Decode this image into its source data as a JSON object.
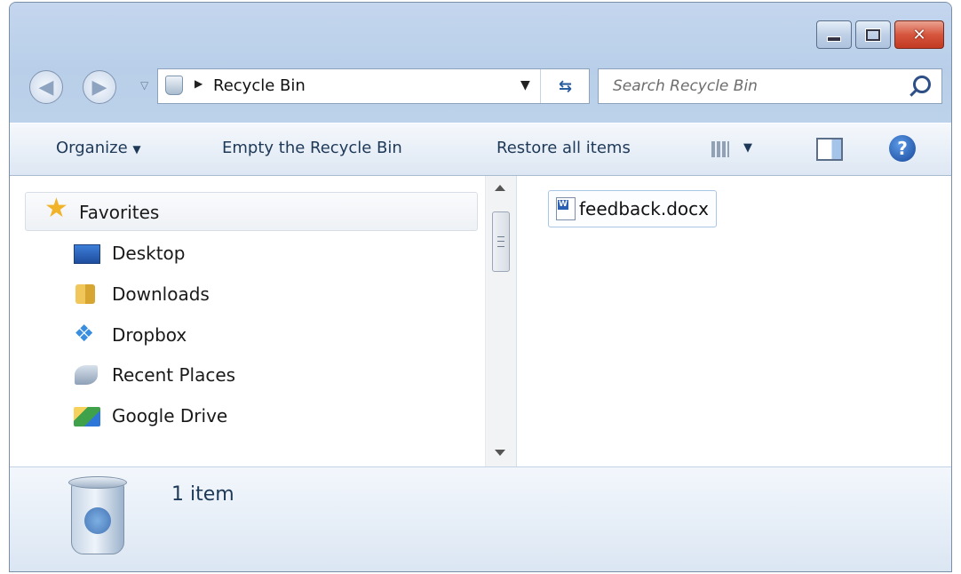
{
  "window": {
    "controls": [
      "minimize",
      "maximize",
      "close"
    ]
  },
  "nav": {
    "back_icon": "back-arrow-icon",
    "forward_icon": "forward-arrow-icon"
  },
  "address": {
    "location": "Recycle Bin",
    "icon": "recycle-bin-icon"
  },
  "search": {
    "placeholder": "Search Recycle Bin"
  },
  "toolbar": {
    "organize": "Organize",
    "empty": "Empty the Recycle Bin",
    "restore": "Restore all items"
  },
  "sidebar": {
    "header": "Favorites",
    "items": [
      {
        "label": "Desktop",
        "icon": "desktop-icon"
      },
      {
        "label": "Downloads",
        "icon": "downloads-folder-icon"
      },
      {
        "label": "Dropbox",
        "icon": "dropbox-icon"
      },
      {
        "label": "Recent Places",
        "icon": "recent-places-icon"
      },
      {
        "label": "Google Drive",
        "icon": "google-drive-icon"
      }
    ]
  },
  "files": [
    {
      "name": "feedback.docx",
      "icon": "word-document-icon"
    }
  ],
  "details": {
    "count": "1 item"
  },
  "colors": {
    "titlebar": "#c4d6ee",
    "close_button": "#d6563d",
    "toolbar_text": "#1e3958"
  }
}
